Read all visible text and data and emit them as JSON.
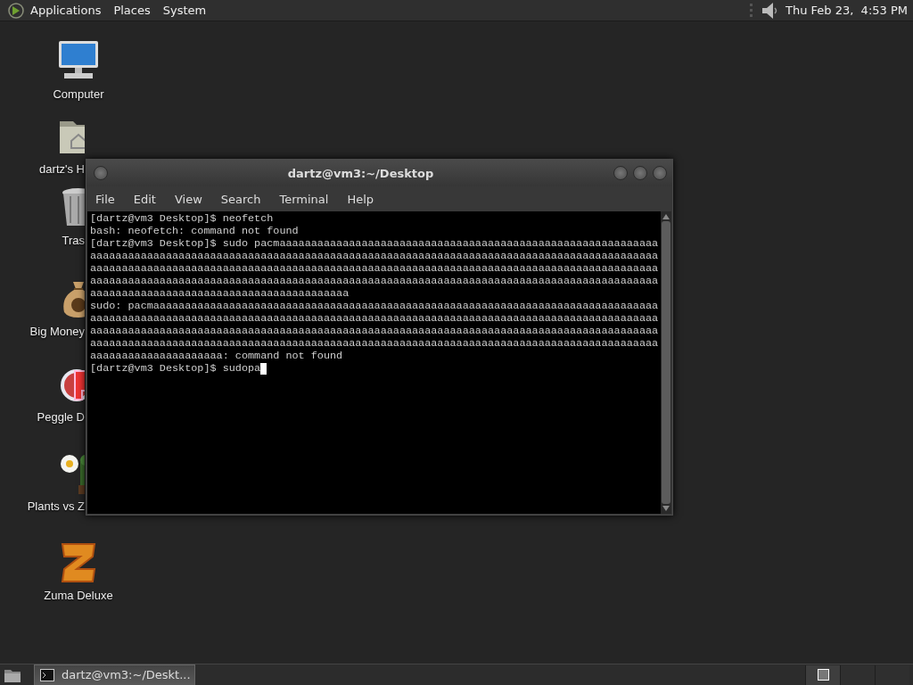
{
  "top_panel": {
    "menus": [
      "Applications",
      "Places",
      "System"
    ],
    "clock": "Thu Feb 23,  4:53 PM"
  },
  "desktop_icons": [
    {
      "label": "Computer",
      "kind": "computer"
    },
    {
      "label": "dartz's H",
      "kind": "home"
    },
    {
      "label": "Tras",
      "kind": "trash"
    },
    {
      "label": "Big Money",
      "kind": "moneybag"
    },
    {
      "label": "Peggle D",
      "kind": "peggle"
    },
    {
      "label": "Plants vs Z",
      "kind": "plants"
    },
    {
      "label": "Zuma Deluxe",
      "kind": "zuma"
    }
  ],
  "terminal_window": {
    "title": "dartz@vm3:~/Desktop",
    "menu": [
      "File",
      "Edit",
      "View",
      "Search",
      "Terminal",
      "Help"
    ],
    "lines": [
      "[dartz@vm3 Desktop]$ neofetch",
      "bash: neofetch: command not found",
      "[dartz@vm3 Desktop]$ sudo pacmaaaaaaaaaaaaaaaaaaaaaaaaaaaaaaaaaaaaaaaaaaaaaaaaaaaaaaaaaaaa",
      "aaaaaaaaaaaaaaaaaaaaaaaaaaaaaaaaaaaaaaaaaaaaaaaaaaaaaaaaaaaaaaaaaaaaaaaaaaaaaaaaaaaaaaaaaa",
      "aaaaaaaaaaaaaaaaaaaaaaaaaaaaaaaaaaaaaaaaaaaaaaaaaaaaaaaaaaaaaaaaaaaaaaaaaaaaaaaaaaaaaaaaaa",
      "aaaaaaaaaaaaaaaaaaaaaaaaaaaaaaaaaaaaaaaaaaaaaaaaaaaaaaaaaaaaaaaaaaaaaaaaaaaaaaaaaaaaaaaaaa",
      "aaaaaaaaaaaaaaaaaaaaaaaaaaaaaaaaaaaaaaaaa",
      "sudo: pacmaaaaaaaaaaaaaaaaaaaaaaaaaaaaaaaaaaaaaaaaaaaaaaaaaaaaaaaaaaaaaaaaaaaaaaaaaaaaaaaa",
      "aaaaaaaaaaaaaaaaaaaaaaaaaaaaaaaaaaaaaaaaaaaaaaaaaaaaaaaaaaaaaaaaaaaaaaaaaaaaaaaaaaaaaaaaaa",
      "aaaaaaaaaaaaaaaaaaaaaaaaaaaaaaaaaaaaaaaaaaaaaaaaaaaaaaaaaaaaaaaaaaaaaaaaaaaaaaaaaaaaaaaaaa",
      "aaaaaaaaaaaaaaaaaaaaaaaaaaaaaaaaaaaaaaaaaaaaaaaaaaaaaaaaaaaaaaaaaaaaaaaaaaaaaaaaaaaaaaaaaa",
      "aaaaaaaaaaaaaaaaaaaaa: command not found"
    ],
    "input_line": {
      "prompt": "[dartz@vm3 Desktop]$ ",
      "typed": "sudopa"
    },
    "cursor_visible": true
  },
  "taskbar": {
    "tasks": [
      {
        "label": "dartz@vm3:~/Deskt...",
        "selected": true
      }
    ],
    "workspaces": [
      {
        "selected": true
      },
      {
        "selected": false
      },
      {
        "selected": false
      }
    ]
  }
}
